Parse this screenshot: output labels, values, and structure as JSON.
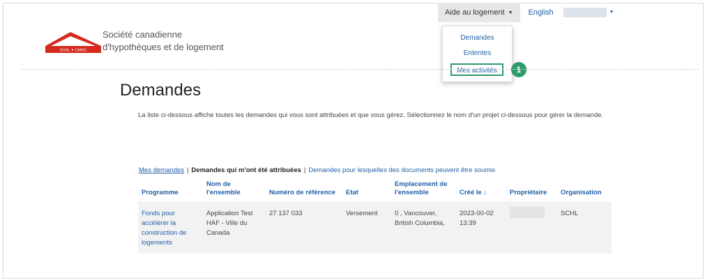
{
  "nav": {
    "assistance_label": "Aide au logement",
    "language_label": "English"
  },
  "dropdown": {
    "items": [
      "Demandes",
      "Ententes",
      "Mes activités"
    ],
    "callout": "1"
  },
  "logo": {
    "emblem_text": "SCHL ✦ CMHC",
    "line1": "Société canadienne",
    "line2": "d'hypothèques et de logement"
  },
  "page": {
    "title": "Demandes",
    "intro": "La liste ci-dessous affiche toutes les demandes qui vous sont attribuées et que vous gérez. Sélectionnez le nom d'un projet ci-dessous pour gérer la demande."
  },
  "tabs": {
    "mine": "Mes demandes",
    "assigned": "Demandes qui m'ont été attribuées",
    "docs": "Demandes pour lesquelles des documents peuvent être soumis"
  },
  "table": {
    "headers": [
      "Programme",
      "Nom de l'ensemble",
      "Numéro de référence",
      "Etat",
      "Emplacement de l'ensemble",
      "Créé le ↓",
      "Propriétaire",
      "Organisation"
    ],
    "rows": [
      [
        "Fonds pour accélérer la construction de logements",
        "Application Test HAF - Ville du Canada",
        "27 137 033",
        "Versement",
        "0 , Vancouver, British Columbia,",
        "2023-00-02 13:39",
        "",
        "SCHL"
      ]
    ]
  },
  "colors": {
    "accent": "#2e9b6d",
    "link": "#1f5fa8",
    "logo_red": "#d52b1e"
  }
}
